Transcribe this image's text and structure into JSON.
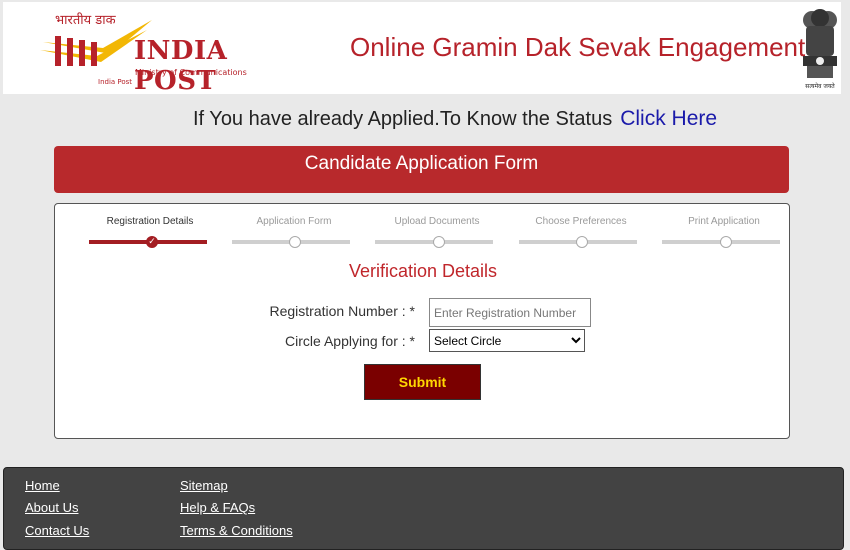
{
  "header": {
    "logo_hindi": "भारतीय डाक",
    "logo_title": "INDIA POST",
    "logo_subtitle": "Ministry of Communications",
    "logo_small": "India Post",
    "site_title": "Online Gramin Dak Sevak Engagement",
    "emblem_text": "सत्यमेव जयते",
    "brand_color": "#b6222a"
  },
  "status": {
    "question": "If You have already Applied.To Know the Status",
    "link_label": "Click Here"
  },
  "form": {
    "banner_title": "Candidate Application Form",
    "steps": [
      {
        "label": "Registration Details",
        "state": "completed"
      },
      {
        "label": "Application Form",
        "state": "pending"
      },
      {
        "label": "Upload Documents",
        "state": "pending"
      },
      {
        "label": "Choose Preferences",
        "state": "pending"
      },
      {
        "label": "Print Application",
        "state": "pending"
      }
    ],
    "section_title": "Verification Details",
    "registration_label": "Registration Number : *",
    "registration_placeholder": "Enter Registration Number",
    "registration_value": "",
    "circle_label": "Circle Applying for : *",
    "circle_selected": "Select Circle",
    "submit_label": "Submit"
  },
  "footer": {
    "links_col1": [
      "Home",
      "About Us",
      "Contact Us"
    ],
    "links_col2": [
      "Sitemap",
      "Help & FAQs",
      "Terms & Conditions"
    ]
  }
}
